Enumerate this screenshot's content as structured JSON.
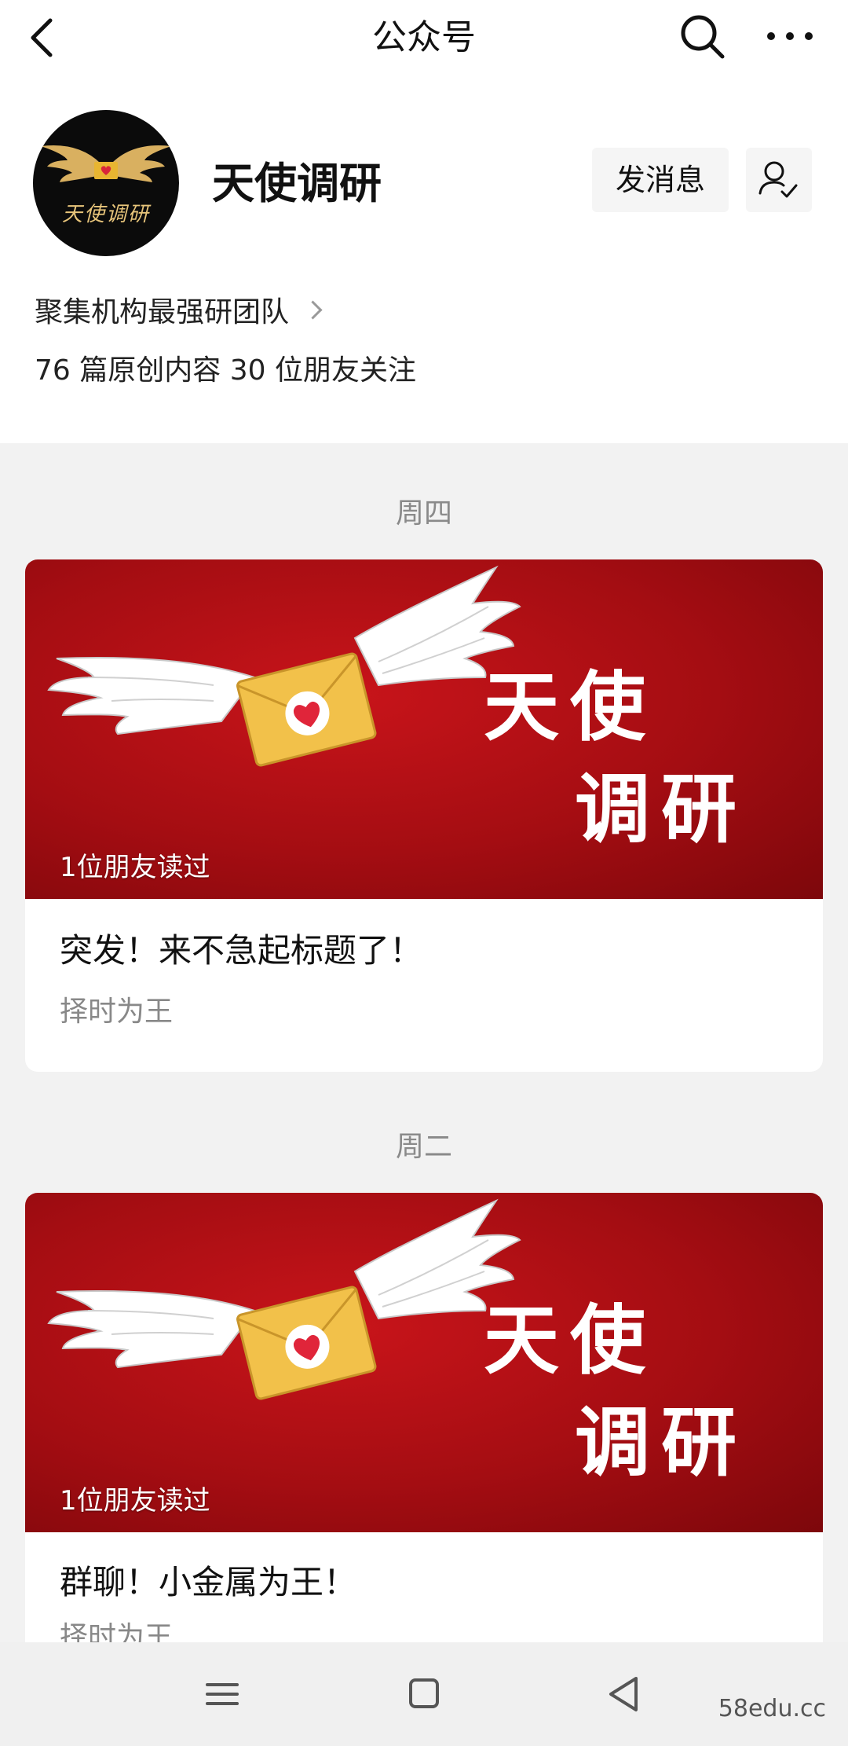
{
  "topbar": {
    "title": "公众号"
  },
  "profile": {
    "name": "天使调研",
    "avatar_text": "天使调研",
    "message_button": "发消息",
    "intro": "聚集机构最强研团队",
    "stats": "76 篇原创内容  30 位朋友关注"
  },
  "feed": [
    {
      "day": "周四",
      "cover_text": [
        "天使",
        "调研"
      ],
      "readers": "1位朋友读过",
      "title": "突发！来不急起标题了！",
      "subtitle": "择时为王"
    },
    {
      "day": "周二",
      "cover_text": [
        "天使",
        "调研"
      ],
      "readers": "1位朋友读过",
      "title": "群聊！小金属为王！",
      "subtitle": "择时为王"
    }
  ],
  "watermark": "58edu.cc",
  "colors": {
    "cover_red": "#b3101a",
    "envelope": "#f2c14a",
    "heart": "#e0253a"
  }
}
